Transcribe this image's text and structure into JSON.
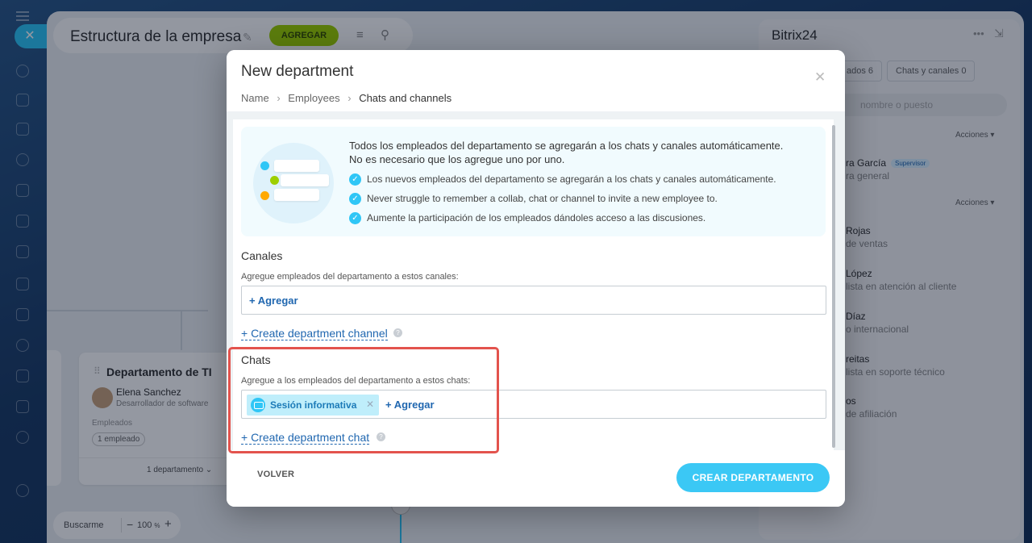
{
  "app": {
    "title": "Estructura de la empresa",
    "add_button": "AGREGAR",
    "org_card": {
      "title": "Departamento de TI",
      "head_name": "Elena Sanchez",
      "head_role": "Desarrollador de software",
      "employees_label": "Empleados",
      "employees_badge": "1 empleado",
      "subdepartments": "1 departamento"
    },
    "zoom": {
      "find_me": "Buscarme",
      "minus": "−",
      "value": "100",
      "unit": "%",
      "plus": "+"
    }
  },
  "right_panel": {
    "title": "Bitrix24",
    "tab_employees": "ados 6",
    "tab_chats": "Chats y canales 0",
    "search_placeholder": "nombre o puesto",
    "actions_label_1": "Acciones",
    "actions_label_2": "Acciones",
    "people": [
      {
        "name": "ra García",
        "role": "ra general",
        "badge": "Supervisor"
      },
      {
        "name": "Rojas",
        "role": "de ventas"
      },
      {
        "name": "López",
        "role": "lista en atención al cliente"
      },
      {
        "name": "Díaz",
        "role": "o internacional"
      },
      {
        "name": "reitas",
        "role": "lista en soporte técnico"
      },
      {
        "name": "os",
        "role": "de afiliación"
      }
    ]
  },
  "modal": {
    "title": "New department",
    "breadcrumbs": [
      "Name",
      "Employees",
      "Chats and channels"
    ],
    "info": {
      "heading_line1": "Todos los empleados del departamento se agregarán a los chats y canales automáticamente.",
      "heading_line2": "No es necesario que los agregue uno por uno.",
      "items": [
        "Los nuevos empleados del departamento se agregarán a los chats y canales automáticamente.",
        "Never struggle to remember a collab, chat or channel to invite a new employee to.",
        "Aumente la participación de los empleados dándoles acceso a las discusiones."
      ]
    },
    "channels": {
      "title": "Canales",
      "help": "Agregue empleados del departamento a estos canales:",
      "add_label": "+ Agregar",
      "create_link": "+ Create department channel"
    },
    "chats": {
      "title": "Chats",
      "help": "Agregue a los empleados del departamento a estos chats:",
      "selected_chat": "Sesión informativa",
      "add_label": "+ Agregar",
      "create_link": "+ Create department chat"
    },
    "footer": {
      "back": "VOLVER",
      "create": "CREAR DEPARTAMENTO"
    }
  },
  "colors": {
    "accent": "#2fc6f6",
    "link": "#2067b0",
    "add_green": "#9dcf00",
    "highlight_red": "#e3534d"
  },
  "icons": [
    "menu-icon",
    "close-icon",
    "pin-icon",
    "list-icon",
    "search-icon",
    "more-icon",
    "collapse-icon",
    "check-icon",
    "help-icon",
    "chat-icon",
    "remove-icon",
    "chevron-down-icon"
  ]
}
